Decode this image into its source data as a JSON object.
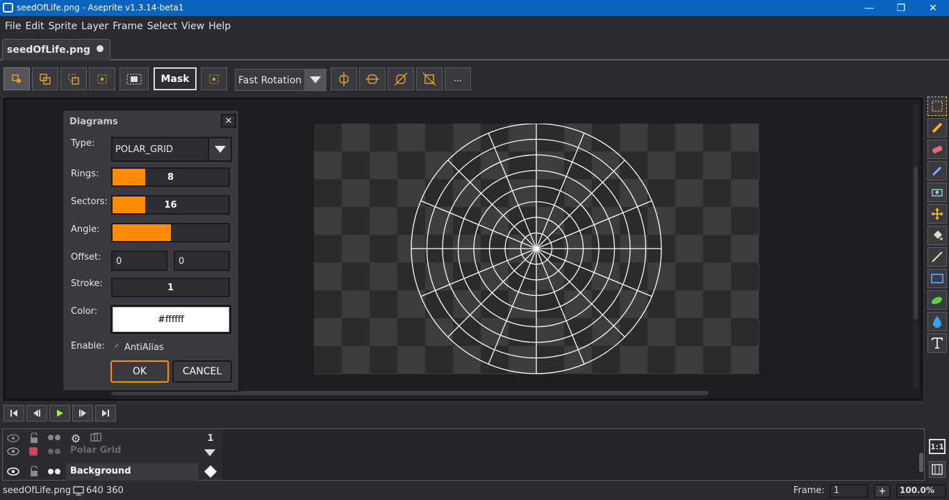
{
  "window": {
    "title": "seedOfLife.png - Aseprite v1.3.14-beta1"
  },
  "menu": [
    "File",
    "Edit",
    "Sprite",
    "Layer",
    "Frame",
    "Select",
    "View",
    "Help"
  ],
  "tab": {
    "label": "seedOfLife.png"
  },
  "toolbar": {
    "mask_label": "Mask",
    "rotation_mode": "Fast Rotation",
    "more_label": "..."
  },
  "dialog": {
    "title": "Diagrams",
    "type_label": "Type:",
    "type_value": "POLAR_GRID",
    "rings_label": "Rings:",
    "rings_value": "8",
    "rings_fraction": 0.28,
    "sectors_label": "Sectors:",
    "sectors_value": "16",
    "sectors_fraction": 0.28,
    "angle_label": "Angle:",
    "angle_fraction": 0.5,
    "offset_label": "Offset:",
    "offset_x": "0",
    "offset_y": "0",
    "stroke_label": "Stroke:",
    "stroke_value": "1",
    "color_label": "Color:",
    "color_value": "#ffffff",
    "enable_label": "Enable:",
    "antialias_label": "AntiAlias",
    "antialias_checked": true,
    "ok_label": "OK",
    "cancel_label": "CANCEL"
  },
  "layers": {
    "frame_header": "1",
    "items": [
      {
        "name": "Polar Grid"
      },
      {
        "name": "Background"
      }
    ]
  },
  "timeline": {
    "zoom_ratio": "1:1"
  },
  "status": {
    "filename": "seedOfLife.png",
    "size": "640 360",
    "frame_label": "Frame:",
    "frame_value": "1",
    "add_frame": "+",
    "zoom": "100.0%"
  },
  "colors": {
    "accent": "#ff8c00",
    "titlebar": "#0b63c0",
    "grid_stroke": "#ffffff"
  }
}
